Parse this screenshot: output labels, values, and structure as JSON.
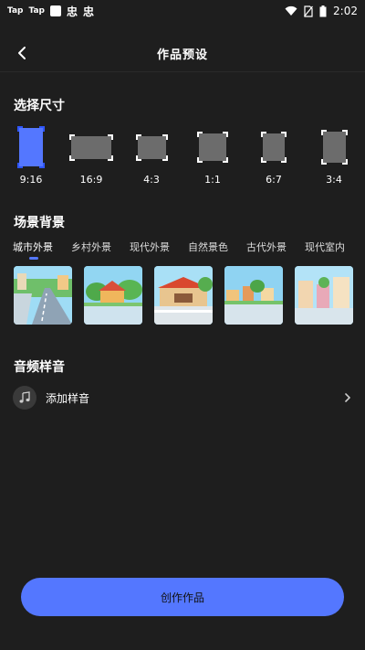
{
  "status_bar": {
    "app_icon_1": "Tap",
    "app_icon_2": "Tap",
    "glyph_1": "忠",
    "glyph_2": "忠",
    "time": "2:02"
  },
  "header": {
    "title": "作品预设"
  },
  "size_section": {
    "title": "选择尺寸",
    "ratios": [
      {
        "label": "9:16",
        "selected": true
      },
      {
        "label": "16:9",
        "selected": false
      },
      {
        "label": "4:3",
        "selected": false
      },
      {
        "label": "1:1",
        "selected": false
      },
      {
        "label": "6:7",
        "selected": false
      },
      {
        "label": "3:4",
        "selected": false
      }
    ]
  },
  "scene_section": {
    "title": "场景背景",
    "tabs": [
      "城市外景",
      "乡村外景",
      "现代外景",
      "自然景色",
      "古代外景",
      "现代室内"
    ],
    "active_tab": "城市外景"
  },
  "audio_section": {
    "title": "音频样音",
    "add_label": "添加样音"
  },
  "create_button": {
    "label": "创作作品"
  },
  "colors": {
    "background": "#1e1e1e",
    "accent": "#5477ff",
    "frame_gray": "#6c6c6c"
  }
}
